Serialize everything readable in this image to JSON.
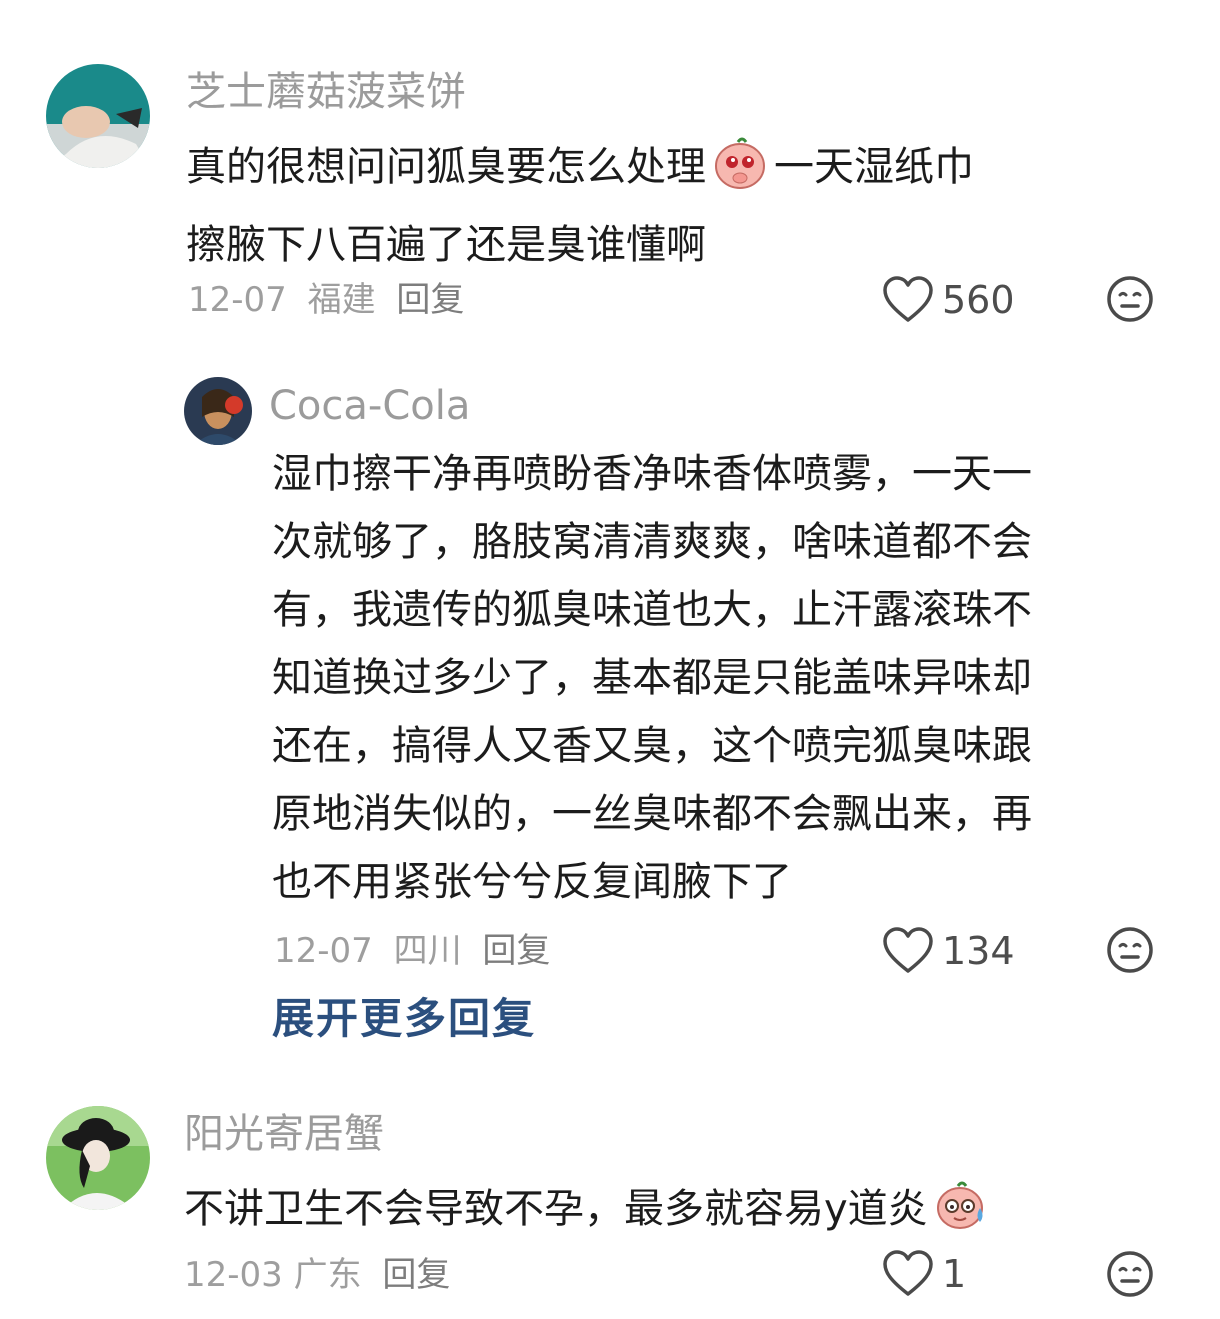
{
  "comments": [
    {
      "username": "芝士蘑菇菠菜饼",
      "text_line1": "真的很想问问狐臭要怎么处理",
      "text_line1_after": "一天湿纸巾",
      "text_line2": "擦腋下八百遍了还是臭谁懂啊",
      "date": "12-07",
      "location": "福建",
      "reply_label": "回复",
      "likes": "560",
      "emoji": "pleading-face-emoji"
    },
    {
      "username": "Coca-Cola",
      "lines": [
        "湿巾擦干净再喷盼香净味香体喷雾，一天一",
        "次就够了，胳肢窝清清爽爽，啥味道都不会",
        "有，我遗传的狐臭味道也大，止汗露滚珠不",
        "知道换过多少了，基本都是只能盖味异味却",
        "还在，搞得人又香又臭，这个喷完狐臭味跟",
        "原地消失似的，一丝臭味都不会飘出来，再",
        "也不用紧张兮兮反复闻腋下了"
      ],
      "date": "12-07",
      "location": "四川",
      "reply_label": "回复",
      "likes": "134"
    },
    {
      "username": "阳光寄居蟹",
      "text": "不讲卫生不会导致不孕，最多就容易y道炎",
      "date": "12-03",
      "location": "广东",
      "reply_label": "回复",
      "likes": "1",
      "emoji": "sweat-face-emoji"
    }
  ],
  "expand_label": "展开更多回复",
  "icons": {
    "like": "heart-outline-icon",
    "dislike": "neutral-face-icon"
  },
  "colors": {
    "username": "#9b9b9b",
    "expand_link": "#2b4f7e",
    "body": "#1c1c1c"
  }
}
